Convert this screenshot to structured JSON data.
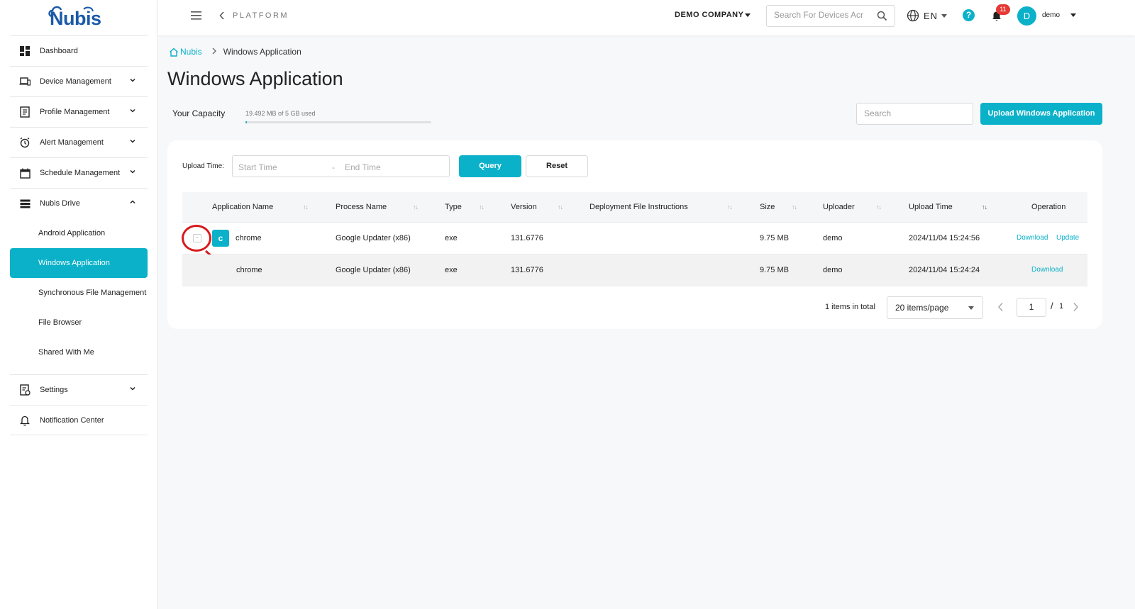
{
  "brand": {
    "logo_text": "Nubis"
  },
  "topbar": {
    "platform": "PLATFORM",
    "company": "DEMO COMPANY",
    "device_search_placeholder": "Search For Devices Acr",
    "language": "EN",
    "help": "?",
    "notifications": "11",
    "avatar_letter": "D",
    "user": "demo"
  },
  "sidebar": {
    "items": [
      {
        "label": "Dashboard"
      },
      {
        "label": "Device Management"
      },
      {
        "label": "Profile Management"
      },
      {
        "label": "Alert Management"
      },
      {
        "label": "Schedule Management"
      },
      {
        "label": "Nubis Drive"
      }
    ],
    "drive_sub": [
      {
        "label": "Android Application"
      },
      {
        "label": "Windows Application"
      },
      {
        "label": "Synchronous File Management"
      },
      {
        "label": "File Browser"
      },
      {
        "label": "Shared With Me"
      }
    ],
    "bottom": [
      {
        "label": "Settings"
      },
      {
        "label": "Notification Center"
      }
    ]
  },
  "breadcrumb": {
    "home": "Nubis",
    "current": "Windows Application"
  },
  "page": {
    "title": "Windows Application",
    "capacity_label": "Your Capacity",
    "capacity_used": "19.492 MB of 5 GB used",
    "capacity_fraction": 0.0038,
    "search_placeholder": "Search",
    "upload_button": "Upload Windows Application"
  },
  "filter": {
    "label": "Upload Time:",
    "start_placeholder": "Start Time",
    "separator": "-",
    "end_placeholder": "End Time",
    "query": "Query",
    "reset": "Reset"
  },
  "table": {
    "headers": {
      "app_name": "Application Name",
      "process_name": "Process Name",
      "type": "Type",
      "version": "Version",
      "deploy": "Deployment File Instructions",
      "size": "Size",
      "uploader": "Uploader",
      "upload_time": "Upload Time",
      "operation": "Operation"
    },
    "rows": [
      {
        "expand": "-",
        "icon_letter": "c",
        "app_name": "chrome",
        "process_name": "Google Updater (x86)",
        "type": "exe",
        "version": "131.6776",
        "size": "9.75 MB",
        "uploader": "demo",
        "upload_time": "2024/11/04 15:24:56",
        "download": "Download",
        "update": "Update"
      },
      {
        "app_name": "chrome",
        "process_name": "Google Updater (x86)",
        "type": "exe",
        "version": "131.6776",
        "size": "9.75 MB",
        "uploader": "demo",
        "upload_time": "2024/11/04 15:24:24",
        "download": "Download"
      }
    ]
  },
  "pagination": {
    "total": "1 items in total",
    "page_size": "20 items/page",
    "current": "1",
    "slash": "/",
    "pages": "1"
  },
  "colors": {
    "accent": "#0ab1c9",
    "annotation": "#d7191c",
    "badge": "#e53935"
  }
}
